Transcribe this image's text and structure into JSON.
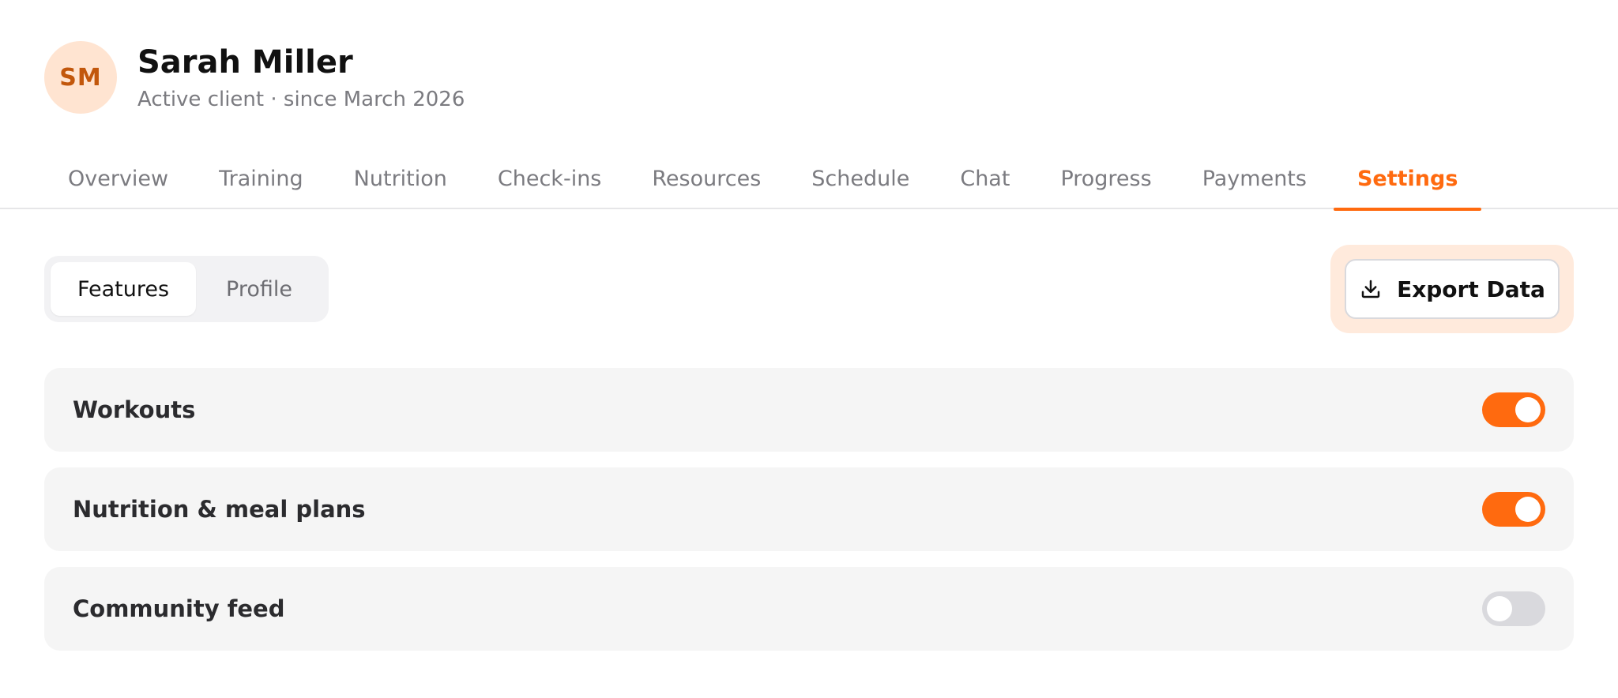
{
  "client": {
    "initials": "SM",
    "name": "Sarah Miller",
    "subtitle": "Active client · since March 2026"
  },
  "tabs": [
    {
      "label": "Overview",
      "active": false
    },
    {
      "label": "Training",
      "active": false
    },
    {
      "label": "Nutrition",
      "active": false
    },
    {
      "label": "Check-ins",
      "active": false
    },
    {
      "label": "Resources",
      "active": false
    },
    {
      "label": "Schedule",
      "active": false
    },
    {
      "label": "Chat",
      "active": false
    },
    {
      "label": "Progress",
      "active": false
    },
    {
      "label": "Payments",
      "active": false
    },
    {
      "label": "Settings",
      "active": true
    }
  ],
  "segments": {
    "features": "Features",
    "profile": "Profile",
    "selected": "Features"
  },
  "export": {
    "label": "Export Data",
    "icon": "download-icon"
  },
  "features": [
    {
      "label": "Workouts",
      "enabled": true
    },
    {
      "label": "Nutrition & meal plans",
      "enabled": true
    },
    {
      "label": "Community feed",
      "enabled": false
    }
  ],
  "colors": {
    "accent": "#ff6a0f",
    "avatar_bg": "#ffe4d1",
    "avatar_text": "#c2570c",
    "toggle_off": "#d9d9dd",
    "row_bg": "#f5f5f5"
  }
}
